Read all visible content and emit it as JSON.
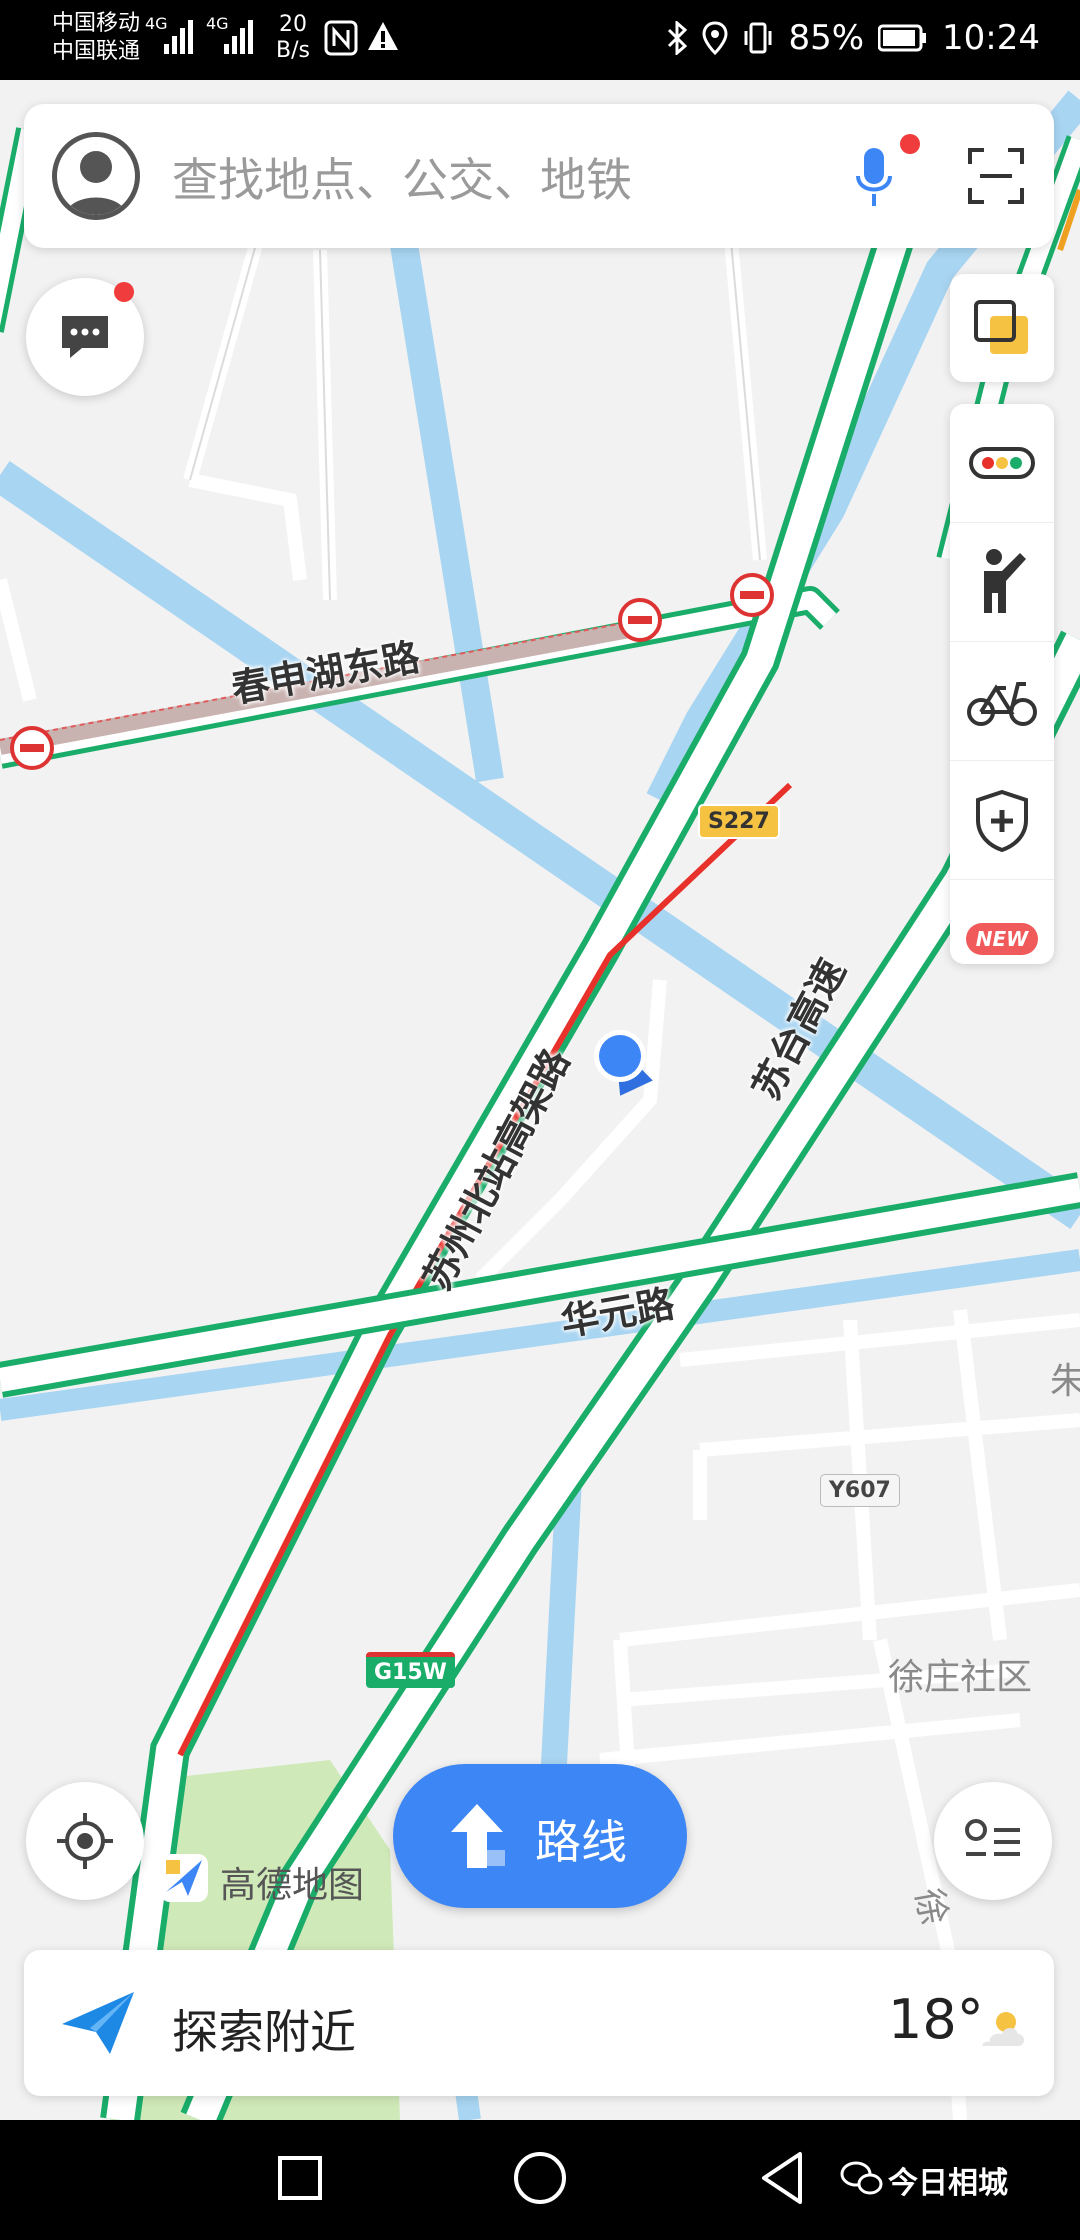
{
  "status_bar": {
    "carrier_1": "中国移动",
    "carrier_2": "中国联通",
    "net_1": "4G",
    "net_2": "4G",
    "speed_value": "20",
    "speed_unit": "B/s",
    "battery": "85%",
    "time": "10:24"
  },
  "search": {
    "placeholder": "查找地点、公交、地铁"
  },
  "map": {
    "roads": {
      "chunshen": "春申湖东路",
      "sufu": "苏州北站高架路",
      "sutai": "苏台高速",
      "huayuan": "华元路",
      "xu": "徐",
      "zhu": "朱"
    },
    "shields": {
      "s227": "S227",
      "y607": "Y607",
      "g15w": "G15W"
    },
    "areas": {
      "xuzhuang": "徐庄社区"
    },
    "logo": "高德地图"
  },
  "side_panel": {
    "new_badge": "NEW"
  },
  "route_button": {
    "label": "路线"
  },
  "bottom_bar": {
    "explore": "探索附近",
    "temperature": "18°"
  },
  "watermark": {
    "brand": "今日相城"
  },
  "colors": {
    "accent": "#3d86f5",
    "road_green": "#1aad6a",
    "road_red": "#e8312a",
    "water": "#a8d5f2"
  }
}
